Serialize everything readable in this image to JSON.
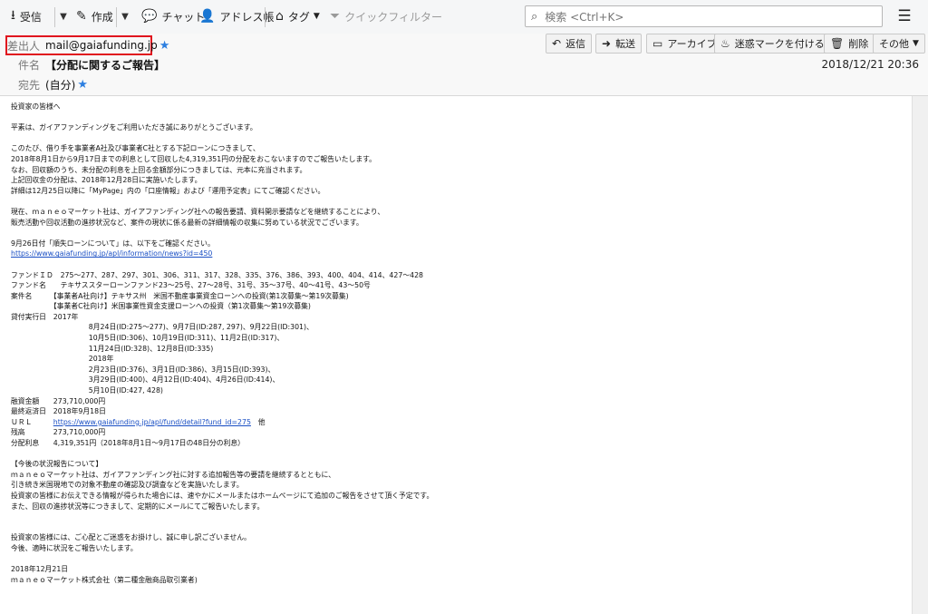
{
  "toolbar": {
    "receive": "受信",
    "compose": "作成",
    "chat": "チャット",
    "address_book": "アドレス帳",
    "tag": "タグ",
    "quick_filter": "クイックフィルター",
    "search_placeholder": "検索 <Ctrl+K>"
  },
  "header": {
    "from_label": "差出人",
    "from_value": "mail@gaiafunding.jp",
    "subject_label": "件名",
    "subject_value": "【分配に関するご報告】",
    "to_label": "宛先",
    "to_value": "(自分)",
    "date": "2018/12/21 20:36",
    "actions": {
      "reply": "返信",
      "forward": "転送",
      "archive": "アーカイブ",
      "junk": "迷惑マークを付ける",
      "delete": "削除",
      "more": "その他"
    }
  },
  "message": {
    "lines": [
      "投資家の皆様へ",
      "",
      "平素は、ガイアファンディングをご利用いただき誠にありがとうございます。",
      "",
      "このたび、借り手を事業者A社及び事業者C社とする下記ローンにつきまして、",
      "2018年8月1日から9月17日までの利息として回収した4,319,351円の分配をおこないますのでご報告いたします。",
      "なお、回収額のうち、未分配の利息を上回る金額部分につきましては、元本に充当されます。",
      "上記回収金の分配は、2018年12月28日に実施いたします。",
      "詳細は12月25日以降に「MyPage」内の「口座情報」および「運用予定表」にてご確認ください。",
      "",
      "現在、ｍａｎｅｏマーケット社は、ガイアファンディング社への報告要請、資料開示要請などを継続することにより、",
      "販売活動や回収活動の進捗状況など、案件の現状に係る最新の詳細情報の収集に努めている状況でございます。",
      "",
      "9月26日付「順失ローンについて」は、以下をご確認ください。",
      "https://www.gaiafunding.jp/apl/information/news?id=450",
      "",
      "ファンドＩＤ　275～277、287、297、301、306、311、317、328、335、376、386、393、400、404、414、427～428",
      "ファンド名　　テキサススターローンファンド23～25号、27～28号、31号、35～37号、40～41号、43～50号",
      "案件名　　　【事業者A社向け】テキサス州　米国不動産事業資金ローンへの投資(第1次募集～第19次募集)",
      "　　　　　　【事業者C社向け】米国事業性資金支援ローンへの投資（第1次募集～第19次募集)",
      "貸付実行日　2017年",
      "　　　　　　　　　　　8月24日(ID:275～277)、9月7日(ID:287, 297)、9月22日(ID:301)、",
      "　　　　　　　　　　　10月5日(ID:306)、10月19日(ID:311)、11月2日(ID:317)、",
      "　　　　　　　　　　　11月24日(ID:328)、12月8日(ID:335)",
      "　　　　　　　　　　　2018年",
      "　　　　　　　　　　　2月23日(ID:376)、3月1日(ID:386)、3月15日(ID:393)、",
      "　　　　　　　　　　　3月29日(ID:400)、4月12日(ID:404)、4月26日(ID:414)、",
      "　　　　　　　　　　　5月10日(ID:427, 428)",
      "融資金額　　273,710,000円",
      "最終返済日　2018年9月18日",
      "ＵＲＬ　　　https://www.gaiafunding.jp/apl/fund/detail?fund_id=275　他",
      "残高　　　　273,710,000円",
      "分配利息　　4,319,351円（2018年8月1日～9月17日の48日分の利息）",
      "",
      "【今後の状況報告について】",
      "ｍａｎｅｏマーケット社は、ガイアファンディング社に対する追加報告等の要請を継続するとともに、",
      "引き続き米国現地での対象不動産の確認及び調査などを実施いたします。",
      "投資家の皆様にお伝えできる情報が得られた場合には、速やかにメールまたはホームページにて追加のご報告をさせて頂く予定です。",
      "また、回収の進捗状況等につきまして、定期的にメールにてご報告いたします。",
      "",
      "",
      "投資家の皆様には、ご心配とご迷惑をお掛けし、誠に申し訳ございません。",
      "今後、適時に状況をご報告いたします。",
      "",
      "2018年12月21日",
      "ｍａｎｅｏマーケット株式会社（第二種金融商品取引業者)"
    ]
  },
  "colors": {
    "highlight_box": "#e0141e",
    "star": "#2d7fe0",
    "link": "#1a4fc4"
  }
}
